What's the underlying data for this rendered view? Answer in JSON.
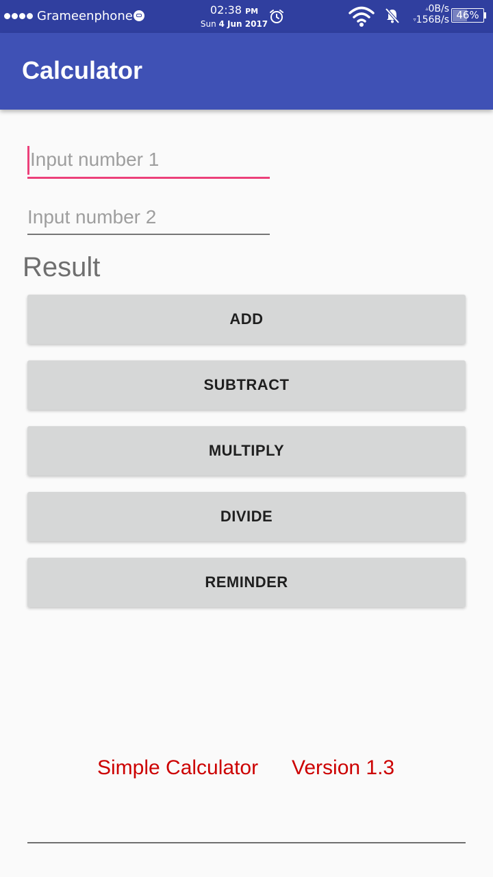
{
  "status_bar": {
    "carrier": "Grameenphone",
    "time": "02:38",
    "ampm": "PM",
    "date_day": "Sun",
    "date_rest": "4 Jun 2017",
    "upload_speed": "0B/s",
    "download_speed": "156B/s",
    "battery_text": "46%",
    "battery_level": 0.46,
    "icons": [
      "signal-dots",
      "carrier-badge-icon",
      "alarm-icon",
      "wifi-icon",
      "bell-off-icon",
      "battery-icon"
    ]
  },
  "app_bar": {
    "title": "Calculator",
    "color": "#3f51b5",
    "status_color": "#303f9f"
  },
  "form": {
    "input1_placeholder": "Input number 1",
    "input1_value": "",
    "input2_placeholder": "Input number 2",
    "input2_value": "",
    "result_label": "Result",
    "accent_color": "#ec407a"
  },
  "buttons": {
    "add": "ADD",
    "subtract": "SUBTRACT",
    "multiply": "MULTIPLY",
    "divide": "DIVIDE",
    "reminder": "REMINDER"
  },
  "footer": {
    "app_name": "Simple Calculator",
    "version": "Version 1.3",
    "color": "#cc0000"
  }
}
